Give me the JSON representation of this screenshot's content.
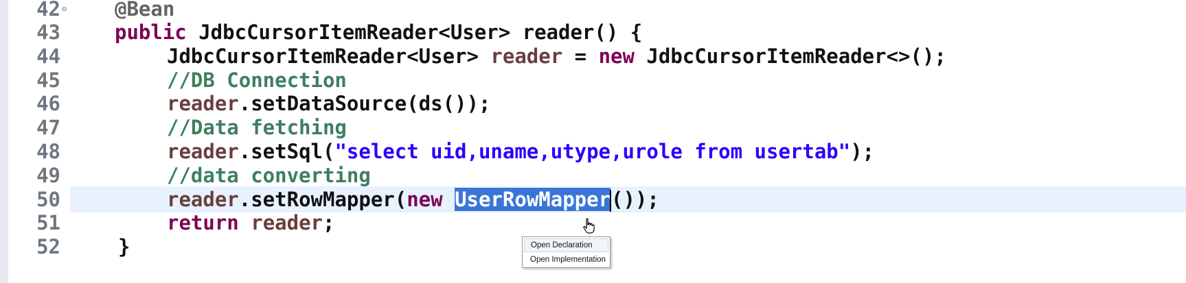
{
  "editor": {
    "lines": [
      {
        "num": "42",
        "tokens": [
          {
            "t": "@Bean",
            "c": "ann"
          }
        ]
      },
      {
        "num": "43",
        "tokens": [
          {
            "t": "public",
            "c": "kw"
          },
          {
            "t": " JdbcCursorItemReader<User> reader() {",
            "c": "cls"
          }
        ]
      },
      {
        "num": "44",
        "tokens": [
          {
            "t": "JdbcCursorItemReader<User> ",
            "c": "cls"
          },
          {
            "t": "reader",
            "c": "var"
          },
          {
            "t": " = ",
            "c": "cls"
          },
          {
            "t": "new",
            "c": "kw"
          },
          {
            "t": " JdbcCursorItemReader<>();",
            "c": "cls"
          }
        ]
      },
      {
        "num": "45",
        "tokens": [
          {
            "t": "//DB Connection",
            "c": "com"
          }
        ]
      },
      {
        "num": "46",
        "tokens": [
          {
            "t": "reader",
            "c": "var"
          },
          {
            "t": ".setDataSource(ds());",
            "c": "cls"
          }
        ]
      },
      {
        "num": "47",
        "tokens": [
          {
            "t": "//Data fetching",
            "c": "com"
          }
        ]
      },
      {
        "num": "48",
        "tokens": [
          {
            "t": "reader",
            "c": "var"
          },
          {
            "t": ".setSql(",
            "c": "cls"
          },
          {
            "t": "\"select uid,uname,utype,urole from usertab\"",
            "c": "str"
          },
          {
            "t": ");",
            "c": "cls"
          }
        ]
      },
      {
        "num": "49",
        "tokens": [
          {
            "t": "//data converting",
            "c": "com"
          }
        ]
      },
      {
        "num": "50",
        "tokens": [
          {
            "t": "reader",
            "c": "var"
          },
          {
            "t": ".setRowMapper(",
            "c": "cls"
          },
          {
            "t": "new",
            "c": "kw"
          },
          {
            "t": " ",
            "c": "cls"
          },
          {
            "t": "UserRowMapper",
            "c": "sel"
          },
          {
            "t": "());",
            "c": "cls"
          }
        ]
      },
      {
        "num": "51",
        "tokens": [
          {
            "t": "return",
            "c": "kw"
          },
          {
            "t": " ",
            "c": "cls"
          },
          {
            "t": "reader",
            "c": "var"
          },
          {
            "t": ";",
            "c": "cls"
          }
        ]
      },
      {
        "num": "52",
        "tokens": [
          {
            "t": "}",
            "c": "cls"
          }
        ]
      }
    ]
  },
  "context_menu": {
    "items": [
      "Open Declaration",
      "Open Implementation"
    ]
  }
}
